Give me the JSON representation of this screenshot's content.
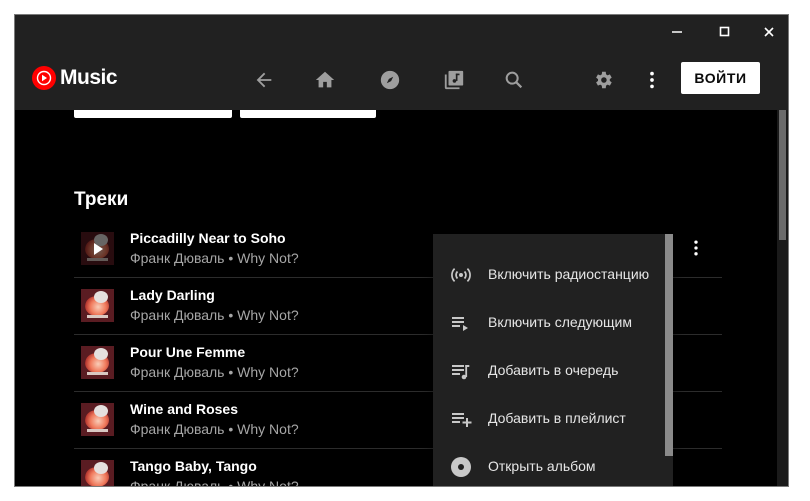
{
  "header": {
    "brand": "Music",
    "login_label": "ВОЙТИ",
    "nav_icons": [
      "back-arrow-icon",
      "home-icon",
      "explore-icon",
      "library-icon",
      "search-icon"
    ],
    "right_icons": [
      "gear-icon",
      "more-vert-icon"
    ]
  },
  "window_controls": [
    "minimize-icon",
    "maximize-icon",
    "close-icon"
  ],
  "section": {
    "title": "Треки"
  },
  "tracks": [
    {
      "title": "Piccadilly Near to Soho",
      "subtitle": "Франк Дюваль • Why Not?",
      "playing_hover": true
    },
    {
      "title": "Lady Darling",
      "subtitle": "Франк Дюваль • Why Not?"
    },
    {
      "title": "Pour Une Femme",
      "subtitle": "Франк Дюваль • Why Not?"
    },
    {
      "title": "Wine and Roses",
      "subtitle": "Франк Дюваль • Why Not?"
    },
    {
      "title": "Tango Baby, Tango",
      "subtitle": "Франк Дюваль • Why Not?"
    }
  ],
  "context_menu": {
    "items": [
      {
        "label": "Включить радиостанцию",
        "icon": "radio-icon"
      },
      {
        "label": "Включить следующим",
        "icon": "play-next-icon"
      },
      {
        "label": "Добавить в очередь",
        "icon": "add-to-queue-icon"
      },
      {
        "label": "Добавить в плейлист",
        "icon": "playlist-add-icon"
      },
      {
        "label": "Открыть альбом",
        "icon": "album-icon"
      }
    ]
  },
  "colors": {
    "brand_red": "#ff0000",
    "background": "#000000",
    "surface": "#212121",
    "text_secondary": "#a6a6a6"
  }
}
